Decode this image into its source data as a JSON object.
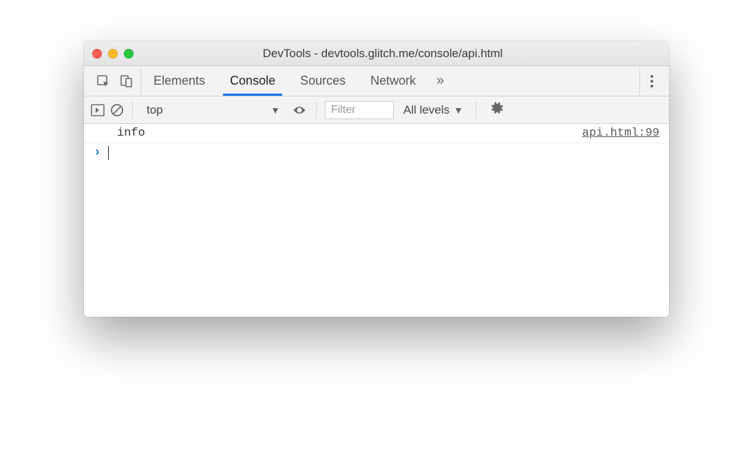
{
  "window": {
    "title": "DevTools - devtools.glitch.me/console/api.html"
  },
  "tabs": {
    "items": [
      "Elements",
      "Console",
      "Sources",
      "Network"
    ],
    "active_index": 1,
    "overflow_glyph": "»"
  },
  "console_toolbar": {
    "context": "top",
    "filter_placeholder": "Filter",
    "filter_value": "",
    "levels_label": "All levels"
  },
  "console": {
    "log_message": "info",
    "log_source": "api.html:99",
    "prompt_glyph": "›"
  }
}
